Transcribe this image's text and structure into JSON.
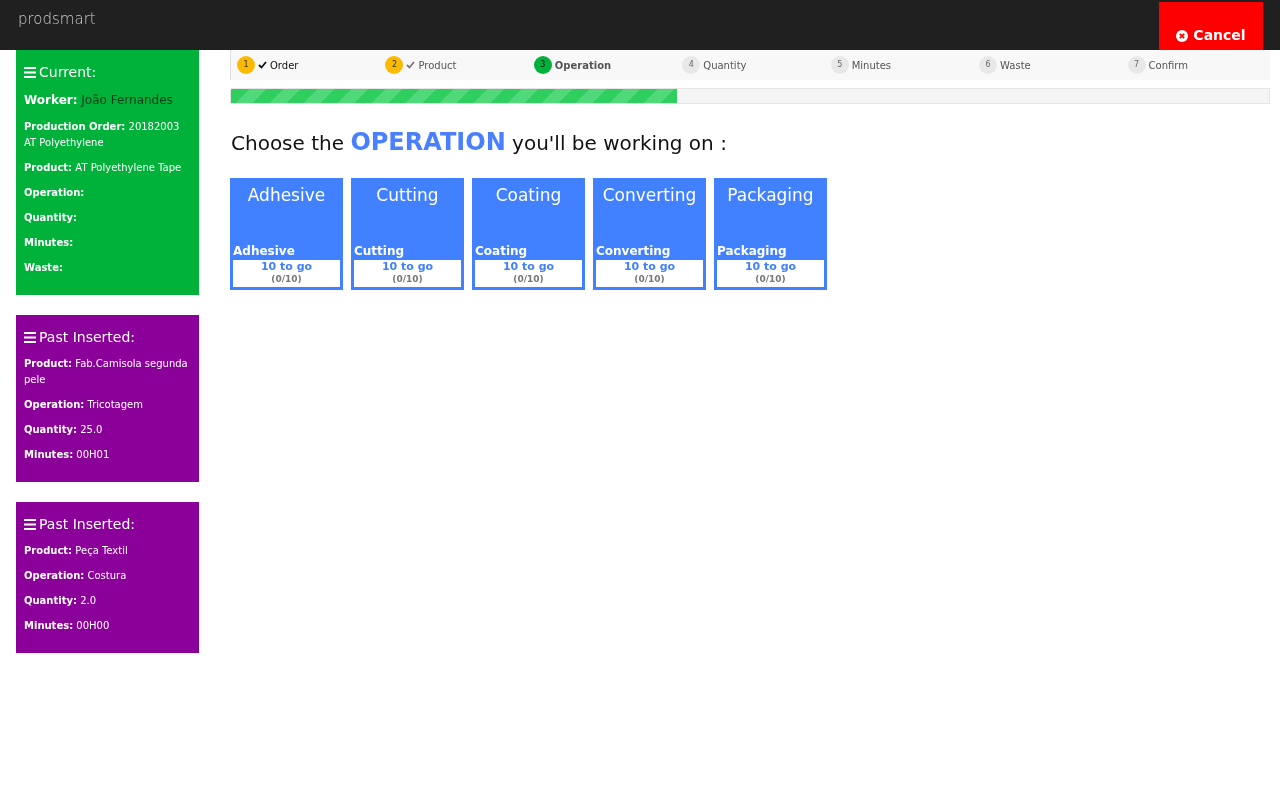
{
  "brand": "prodsmart",
  "cancel_button": {
    "label": "Cancel"
  },
  "current": {
    "title": "Current:",
    "worker": {
      "label": "Worker:",
      "value": "João Fernandes"
    },
    "fields": [
      {
        "label": "Production Order:",
        "value": "20182003 AT Polyethylene"
      },
      {
        "label": "Product:",
        "value": "AT Polyethylene Tape"
      },
      {
        "label": "Operation:"
      },
      {
        "label": "Quantity:"
      },
      {
        "label": "Minutes:"
      },
      {
        "label": "Waste:"
      }
    ]
  },
  "past_inserted": [
    {
      "title": "Past Inserted:",
      "fields": [
        {
          "label": "Product:",
          "value": "Fab.Camisola segunda pele"
        },
        {
          "label": "Operation:",
          "value": "Tricotagem"
        },
        {
          "label": "Quantity:",
          "value": "25.0"
        },
        {
          "label": "Minutes:",
          "value": "00H01"
        }
      ]
    },
    {
      "title": "Past Inserted:",
      "fields": [
        {
          "label": "Product:",
          "value": "Peça Textil"
        },
        {
          "label": "Operation:",
          "value": "Costura"
        },
        {
          "label": "Quantity:",
          "value": "2.0"
        },
        {
          "label": "Minutes:",
          "value": "00H00"
        }
      ]
    }
  ],
  "steps": [
    {
      "number": "1",
      "label": "Order",
      "done": true,
      "selected": false
    },
    {
      "number": "2",
      "label": "Product",
      "done": true,
      "selected": false
    },
    {
      "number": "3",
      "label": "Operation",
      "done": false,
      "selected": true
    },
    {
      "number": "4",
      "label": "Quantity",
      "done": false,
      "selected": false
    },
    {
      "number": "5",
      "label": "Minutes",
      "done": false,
      "selected": false
    },
    {
      "number": "6",
      "label": "Waste",
      "done": false,
      "selected": false
    },
    {
      "number": "7",
      "label": "Confirm",
      "done": false,
      "selected": false
    }
  ],
  "progress": {
    "level": 0.43
  },
  "heading": "Choose the **OPERATION** you'll be working on :",
  "operations": [
    {
      "title": "Adhesive",
      "name": "Adhesive",
      "to_go": "10 to go",
      "count": "(0/10)"
    },
    {
      "title": "Cutting",
      "name": "Cutting",
      "to_go": "10 to go",
      "count": "(0/10)"
    },
    {
      "title": "Coating",
      "name": "Coating",
      "to_go": "10 to go",
      "count": "(0/10)"
    },
    {
      "title": "Converting",
      "name": "Converting",
      "to_go": "10 to go",
      "count": "(0/10)"
    },
    {
      "title": "Packaging",
      "name": "Packaging",
      "to_go": "10 to go",
      "count": "(0/10)"
    }
  ]
}
